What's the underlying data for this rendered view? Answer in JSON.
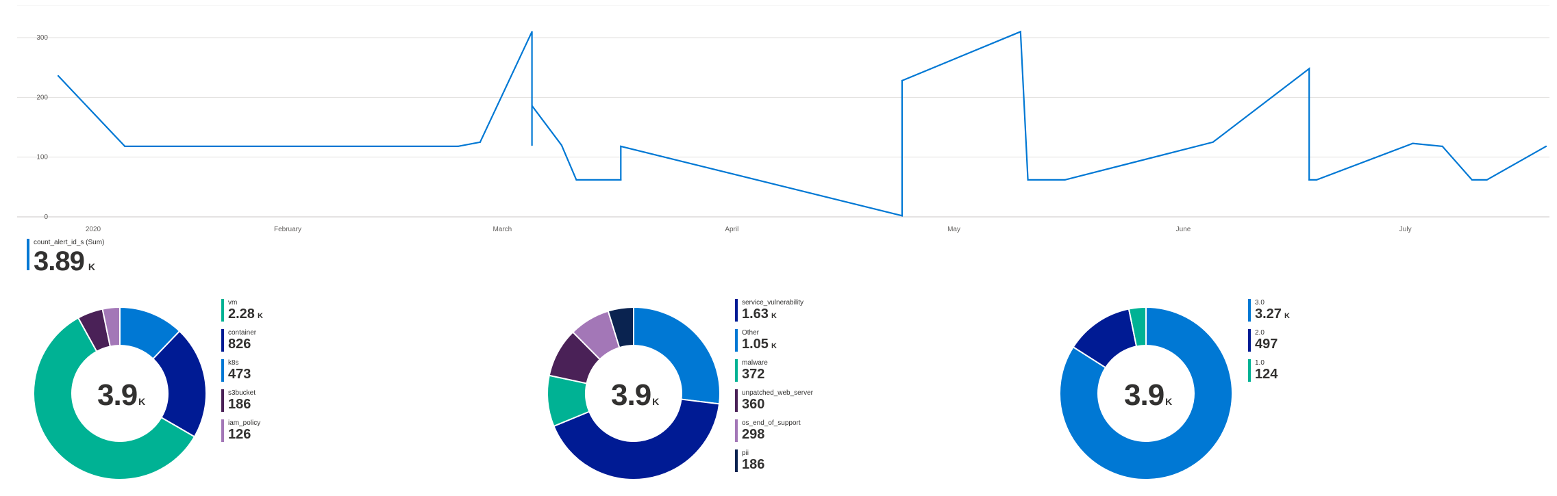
{
  "chart_data": [
    {
      "type": "line",
      "series": [
        {
          "name": "count_alert_id_s (Sum)",
          "color": "#0078d4",
          "points": [
            [
              "2020-01-01",
              236
            ],
            [
              "2020-01-10",
              118
            ],
            [
              "2020-02-24",
              118
            ],
            [
              "2020-02-27",
              125
            ],
            [
              "2020-03-05",
              310
            ],
            [
              "2020-03-05",
              120
            ],
            [
              "2020-03-05",
              186
            ],
            [
              "2020-03-09",
              120
            ],
            [
              "2020-03-11",
              62
            ],
            [
              "2020-03-17",
              62
            ],
            [
              "2020-03-17",
              118
            ],
            [
              "2020-04-24",
              2
            ],
            [
              "2020-04-24",
              228
            ],
            [
              "2020-05-10",
              310
            ],
            [
              "2020-05-11",
              62
            ],
            [
              "2020-05-16",
              62
            ],
            [
              "2020-06-05",
              125
            ],
            [
              "2020-06-18",
              248
            ],
            [
              "2020-06-18",
              62
            ],
            [
              "2020-06-19",
              62
            ],
            [
              "2020-07-02",
              123
            ],
            [
              "2020-07-06",
              118
            ],
            [
              "2020-07-10",
              62
            ],
            [
              "2020-07-12",
              62
            ],
            [
              "2020-07-20",
              118
            ]
          ]
        }
      ],
      "yticks": [
        "300",
        "200",
        "100",
        "0"
      ],
      "xticks": [
        "2020",
        "February",
        "March",
        "April",
        "May",
        "June",
        "July"
      ],
      "ylim": [
        0,
        350
      ],
      "grid": true
    },
    {
      "type": "pie",
      "donut": true,
      "center_label": "3.9",
      "center_unit": "K",
      "slices": [
        {
          "label": "vm",
          "value": 2280,
          "display": "2.28",
          "unit": "K",
          "color": "#00b294"
        },
        {
          "label": "container",
          "value": 826,
          "display": "826",
          "color": "#001b94"
        },
        {
          "label": "k8s",
          "value": 473,
          "display": "473",
          "color": "#0078d4"
        },
        {
          "label": "s3bucket",
          "value": 186,
          "display": "186",
          "color": "#4a2157"
        },
        {
          "label": "iam_policy",
          "value": 126,
          "display": "126",
          "color": "#a377b7"
        }
      ],
      "draw_order": [
        "k8s",
        "container",
        "vm",
        "s3bucket",
        "iam_policy"
      ]
    },
    {
      "type": "pie",
      "donut": true,
      "center_label": "3.9",
      "center_unit": "K",
      "slices": [
        {
          "label": "service_vulnerability",
          "value": 1630,
          "display": "1.63",
          "unit": "K",
          "color": "#001b94"
        },
        {
          "label": "Other",
          "value": 1050,
          "display": "1.05",
          "unit": "K",
          "color": "#0078d4"
        },
        {
          "label": "malware",
          "value": 372,
          "display": "372",
          "color": "#00b294"
        },
        {
          "label": "unpatched_web_server",
          "value": 360,
          "display": "360",
          "color": "#4a2157"
        },
        {
          "label": "os_end_of_support",
          "value": 298,
          "display": "298",
          "color": "#a377b7"
        },
        {
          "label": "pii",
          "value": 186,
          "display": "186",
          "color": "#0a2350"
        }
      ],
      "draw_order": [
        "Other",
        "service_vulnerability",
        "malware",
        "unpatched_web_server",
        "os_end_of_support",
        "pii"
      ]
    },
    {
      "type": "pie",
      "donut": true,
      "center_label": "3.9",
      "center_unit": "K",
      "slices": [
        {
          "label": "3.0",
          "value": 3270,
          "display": "3.27",
          "unit": "K",
          "color": "#0078d4"
        },
        {
          "label": "2.0",
          "value": 497,
          "display": "497",
          "color": "#001b94"
        },
        {
          "label": "1.0",
          "value": 124,
          "display": "124",
          "color": "#00b294"
        }
      ],
      "draw_order": [
        "3.0",
        "2.0",
        "1.0"
      ]
    }
  ],
  "summary": {
    "label": "count_alert_id_s (Sum)",
    "value": "3.89",
    "unit": "K",
    "color": "#0078d4"
  }
}
